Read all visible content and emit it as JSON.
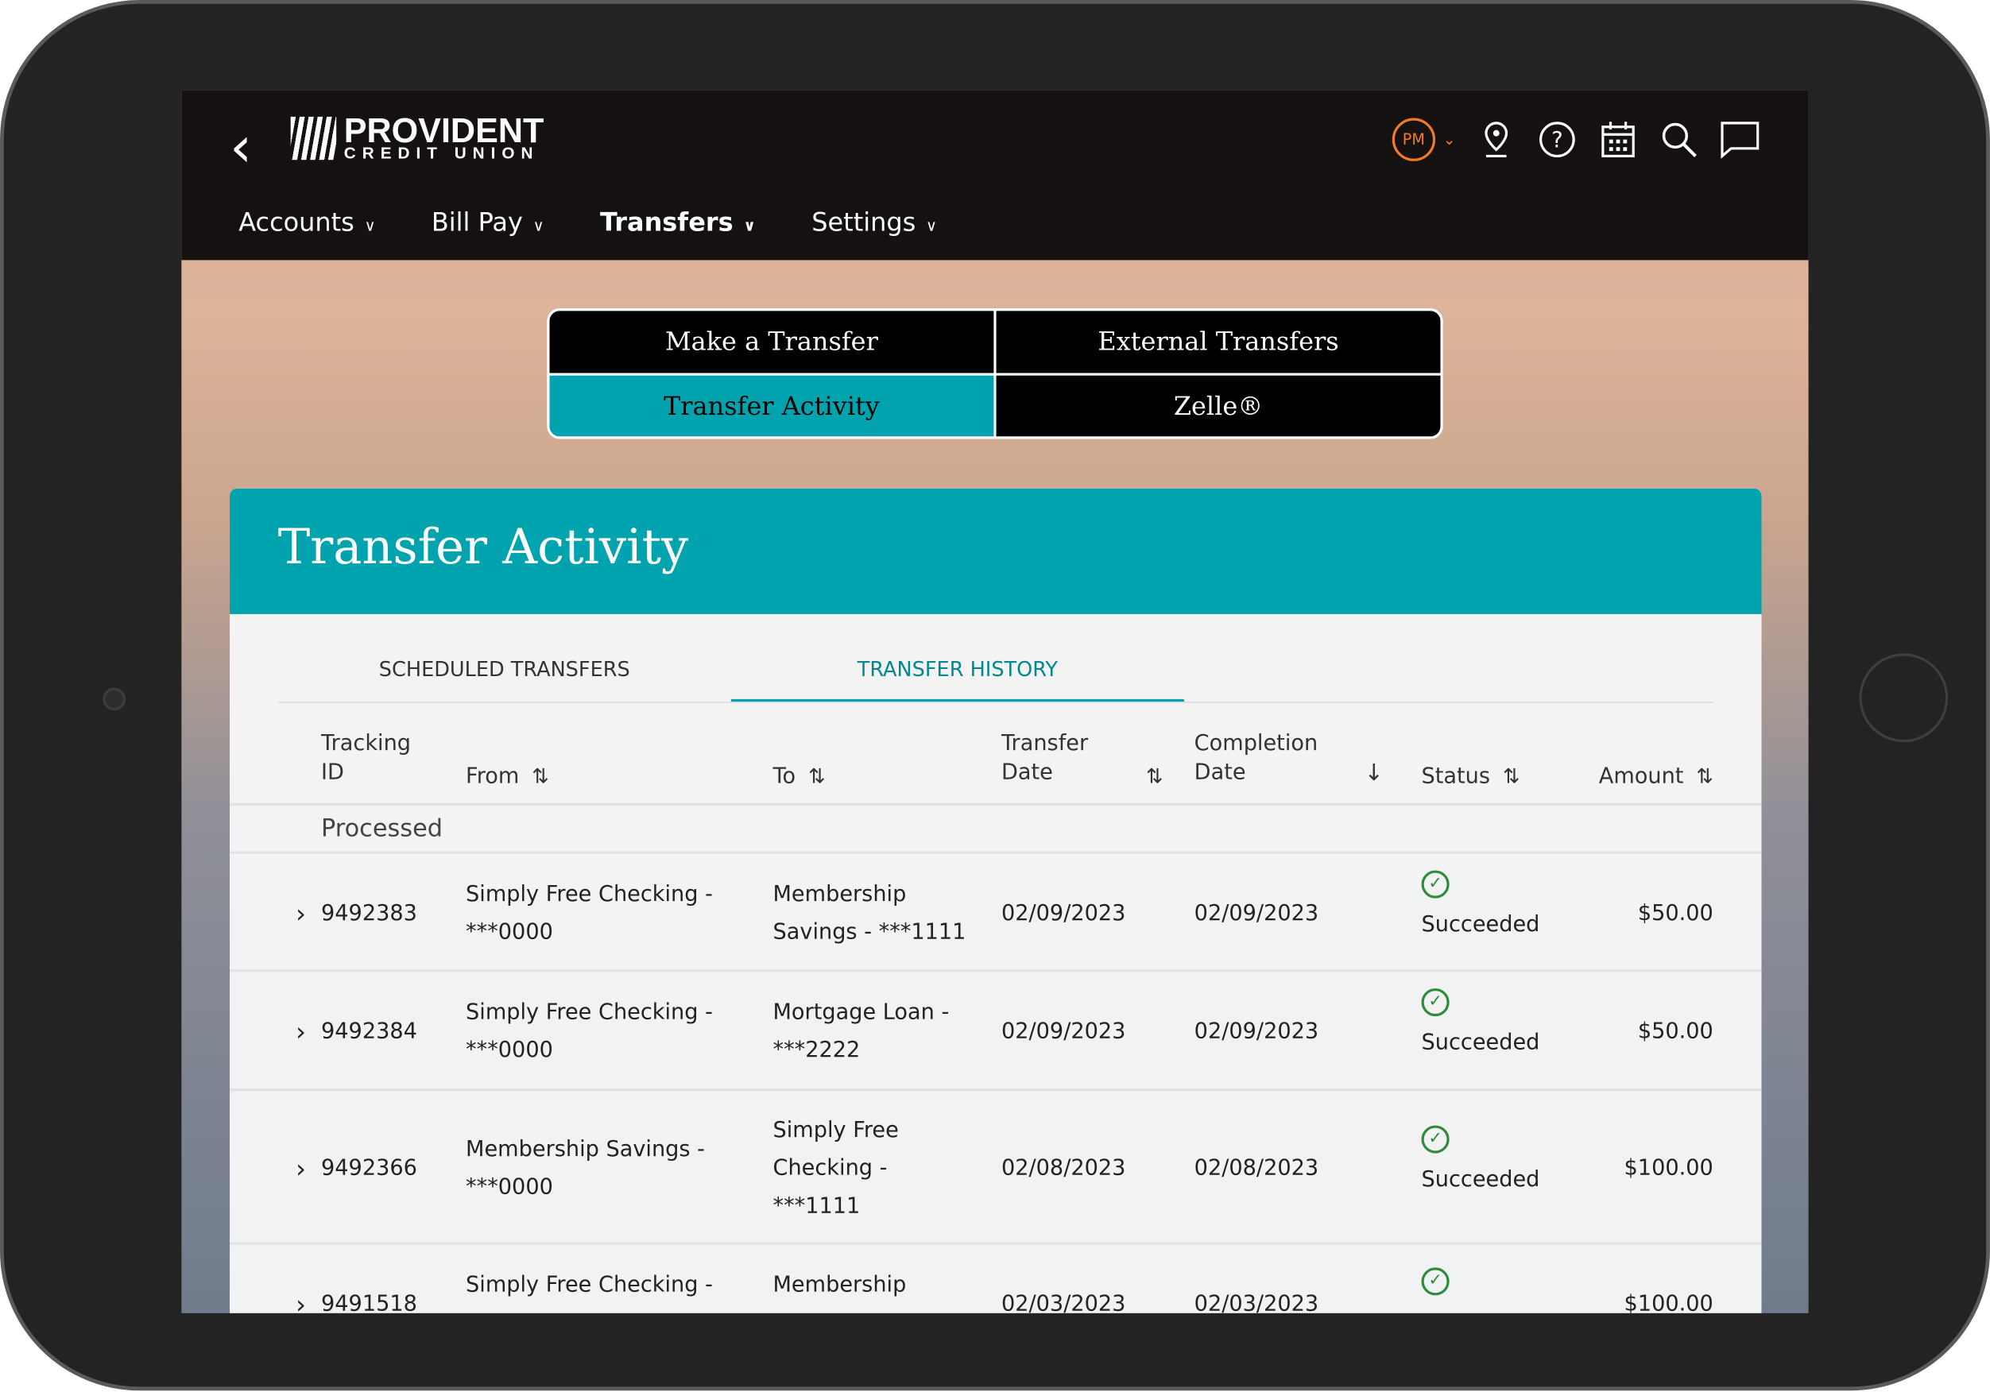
{
  "header": {
    "logo_top": "PROVIDENT",
    "logo_bottom": "CREDIT UNION",
    "avatar_initials": "PM",
    "accent": "#f47c20",
    "nav": [
      {
        "label": "Accounts"
      },
      {
        "label": "Bill Pay"
      },
      {
        "label": "Transfers",
        "active": true
      },
      {
        "label": "Settings"
      }
    ]
  },
  "transfer_menu": {
    "items": [
      "Make a Transfer",
      "External Transfers",
      "Transfer Activity",
      "Zelle®"
    ],
    "active": "Transfer Activity",
    "accent": "#00a3ae"
  },
  "panel": {
    "title": "Transfer Activity",
    "tabs": [
      "SCHEDULED TRANSFERS",
      "TRANSFER HISTORY"
    ],
    "active_tab": "TRANSFER HISTORY"
  },
  "table": {
    "columns": {
      "tracking": "Tracking ID",
      "from": "From",
      "to": "To",
      "transfer_date": "Transfer Date",
      "completion_date": "Completion Date",
      "status": "Status",
      "amount": "Amount"
    },
    "sort": {
      "column": "Completion Date",
      "direction": "descending"
    },
    "group": "Processed",
    "rows": [
      {
        "id": "9492383",
        "from": "Simply Free Checking - ***0000",
        "to": "Membership Savings - ***1111",
        "transfer_date": "02/09/2023",
        "completion_date": "02/09/2023",
        "status": "Succeeded",
        "amount": "$50.00"
      },
      {
        "id": "9492384",
        "from": "Simply Free Checking - ***0000",
        "to": "Mortgage Loan - ***2222",
        "transfer_date": "02/09/2023",
        "completion_date": "02/09/2023",
        "status": "Succeeded",
        "amount": "$50.00"
      },
      {
        "id": "9492366",
        "from": "Membership Savings - ***0000",
        "to": "Simply Free Checking - ***1111",
        "transfer_date": "02/08/2023",
        "completion_date": "02/08/2023",
        "status": "Succeeded",
        "amount": "$100.00"
      },
      {
        "id": "9491518",
        "from": "Simply Free Checking -",
        "to": "Membership",
        "transfer_date": "02/03/2023",
        "completion_date": "02/03/2023",
        "status": "",
        "amount": "$100.00"
      }
    ]
  }
}
